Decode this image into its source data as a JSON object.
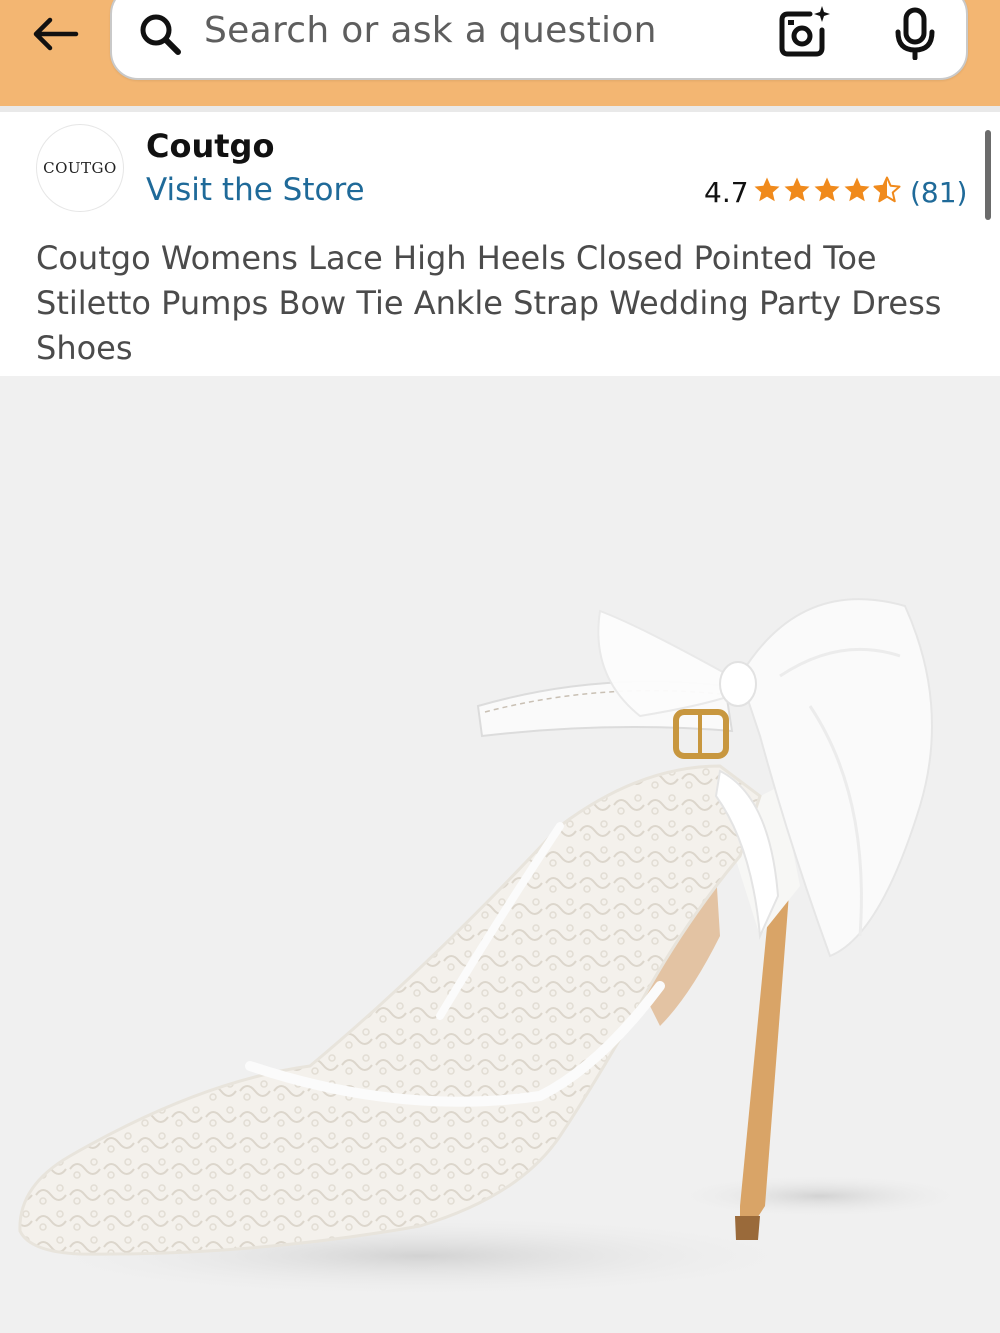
{
  "header": {
    "search": {
      "placeholder": "Search or ask a question"
    },
    "icons": [
      "back-arrow-icon",
      "search-icon",
      "camera-lens-icon",
      "microphone-icon"
    ],
    "colors": {
      "bar": "#f3b672",
      "link": "#1f6a99",
      "stars": "#f08a1c"
    }
  },
  "brand": {
    "logo_text": "COUTGO",
    "name": "Coutgo",
    "visit_store": "Visit the Store"
  },
  "rating": {
    "value": "4.7",
    "stars": 4.5,
    "count": "(81)"
  },
  "product": {
    "title": "Coutgo Womens Lace High Heels Closed Pointed Toe Stiletto Pumps Bow Tie Ankle Strap Wedding Party Dress Shoes"
  }
}
